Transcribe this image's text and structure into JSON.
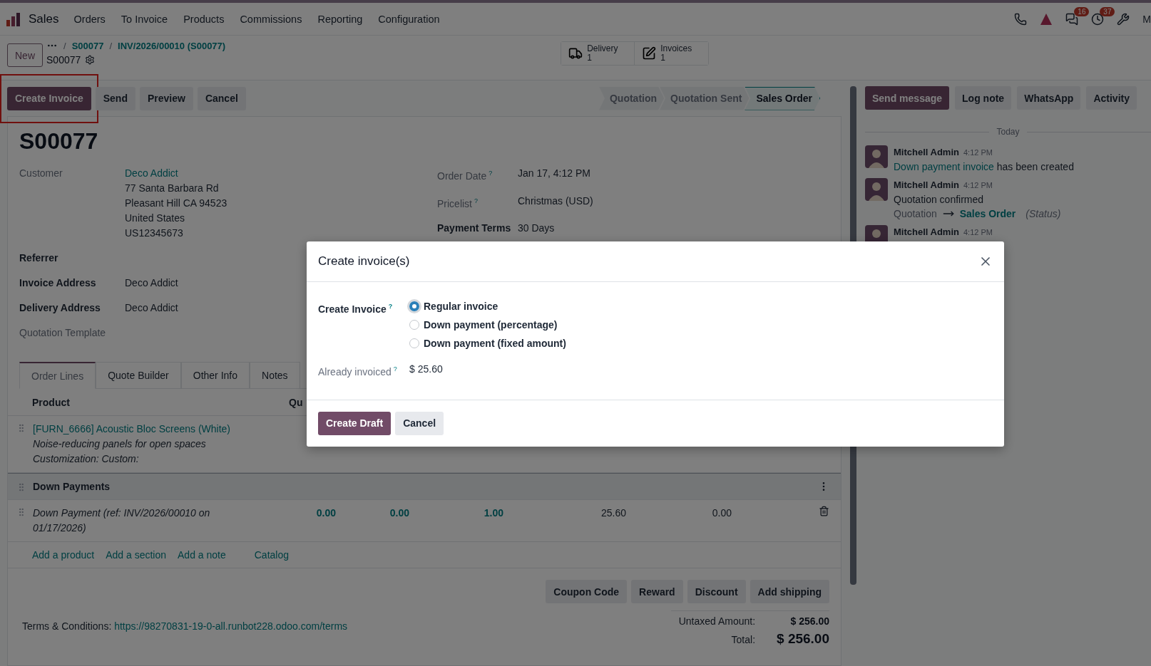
{
  "navbar": {
    "app": "Sales",
    "menu": [
      "Orders",
      "To Invoice",
      "Products",
      "Commissions",
      "Reporting",
      "Configuration"
    ],
    "systray": [
      {
        "kind": "phone"
      },
      {
        "kind": "ai"
      },
      {
        "kind": "chat",
        "badge": "16"
      },
      {
        "kind": "activity",
        "badge": "37"
      },
      {
        "kind": "tools"
      }
    ],
    "user": "M"
  },
  "control_panel": {
    "new_button": "New",
    "separator": "/",
    "breadcrumbs": [
      "S00077",
      "INV/2026/00010 (S00077)"
    ],
    "record": "S00077",
    "smart_buttons": [
      {
        "kind": "delivery",
        "label": "Delivery",
        "count": "1"
      },
      {
        "kind": "invoices",
        "label": "Invoices",
        "count": "1"
      }
    ]
  },
  "actions": [
    {
      "label": "Create Invoice",
      "primary": true,
      "highlighted": true
    },
    {
      "label": "Send",
      "primary": false,
      "highlighted": false
    },
    {
      "label": "Preview",
      "primary": false,
      "highlighted": false
    },
    {
      "label": "Cancel",
      "primary": false,
      "highlighted": false
    }
  ],
  "status_steps": [
    {
      "label": "Quotation",
      "selected": false
    },
    {
      "label": "Quotation Sent",
      "selected": false
    },
    {
      "label": "Sales Order",
      "selected": true
    }
  ],
  "form": {
    "title": "S00077",
    "left_fields": [
      {
        "label": "Customer",
        "bold": false,
        "value": "Deco Addict",
        "link": true,
        "lines": [
          "77 Santa Barbara Rd",
          "Pleasant Hill CA 94523",
          "United States",
          "US12345673"
        ]
      },
      {
        "label": "Referrer",
        "bold": true
      },
      {
        "label": "Invoice Address",
        "bold": true,
        "value": "Deco Addict",
        "link": false
      },
      {
        "label": "Delivery Address",
        "bold": true,
        "value": "Deco Addict",
        "link": false
      },
      {
        "label": "Quotation Template",
        "bold": false
      }
    ],
    "right_fields": [
      {
        "label": "Order Date",
        "bold": false,
        "tip": "?",
        "value": "Jan 17, 4:12 PM",
        "link": false
      },
      {
        "label": "Pricelist",
        "bold": false,
        "tip": "?",
        "value": "Christmas (USD)",
        "link": false
      },
      {
        "label": "Payment Terms",
        "bold": true,
        "value": "30 Days",
        "link": false
      }
    ],
    "tabs": [
      {
        "label": "Order Lines",
        "selected": true
      },
      {
        "label": "Quote Builder",
        "selected": false
      },
      {
        "label": "Other Info",
        "selected": false
      },
      {
        "label": "Notes",
        "selected": false
      }
    ],
    "table": {
      "columns": [
        "Product",
        "Qu"
      ],
      "rows": [
        {
          "kind": "product",
          "product": "[FURN_6666] Acoustic Bloc Screens (White)",
          "lines": [
            "Noise-reducing panels for open spaces",
            "Customization: Custom:"
          ]
        },
        {
          "kind": "section",
          "label": "Down Payments"
        },
        {
          "kind": "line",
          "description": "Down Payment (ref: INV/2026/00010 on 01/17/2026)",
          "cells": [
            {
              "text": "0.00",
              "accent": true
            },
            {
              "text": "0.00",
              "accent": true
            },
            {
              "text": "1.00",
              "accent": true
            },
            {
              "text": "25.60",
              "accent": false
            },
            {
              "text": "0.00",
              "accent": false
            }
          ]
        }
      ],
      "add_links": [
        "Add a product",
        "Add a section",
        "Add a note",
        "Catalog"
      ]
    },
    "extra_buttons": [
      "Coupon Code",
      "Reward",
      "Discount",
      "Add shipping"
    ],
    "terms": {
      "label": "Terms & Conditions:",
      "url": "https://98270831-19-0-all.runbot228.odoo.com/terms"
    },
    "totals": [
      {
        "kind": "subtotal",
        "label": "Untaxed Amount:",
        "value": "$ 256.00"
      },
      {
        "kind": "total",
        "label": "Total:",
        "value": "$ 256.00"
      }
    ]
  },
  "chatter": {
    "buttons": [
      {
        "label": "Send message",
        "primary": true
      },
      {
        "label": "Log note",
        "primary": false
      },
      {
        "label": "WhatsApp",
        "primary": false
      },
      {
        "label": "Activity",
        "primary": false
      }
    ],
    "divider": "Today",
    "messages": [
      {
        "author": "Mitchell Admin",
        "time": "4:12 PM",
        "parts": [
          {
            "text": "Down payment invoice",
            "link": true
          },
          {
            "text": "has been created",
            "link": false
          }
        ]
      },
      {
        "author": "Mitchell Admin",
        "time": "4:12 PM",
        "parts": [
          {
            "text": "Quotation confirmed",
            "link": false
          }
        ],
        "tracking": {
          "old": "Quotation",
          "new": "Sales Order",
          "field": "(Status)"
        }
      },
      {
        "author": "Mitchell Admin",
        "time": "4:12 PM"
      }
    ]
  },
  "dialog": {
    "title": "Create invoice(s)",
    "field_label": "Create Invoice",
    "tip": "?",
    "options": [
      {
        "label": "Regular invoice",
        "selected": true
      },
      {
        "label": "Down payment (percentage)",
        "selected": false
      },
      {
        "label": "Down payment (fixed amount)",
        "selected": false
      }
    ],
    "already_label": "Already invoiced",
    "already_tip": "?",
    "already_value": "$ 25.60",
    "buttons": [
      {
        "label": "Create Draft",
        "primary": true
      },
      {
        "label": "Cancel",
        "primary": false
      }
    ]
  }
}
